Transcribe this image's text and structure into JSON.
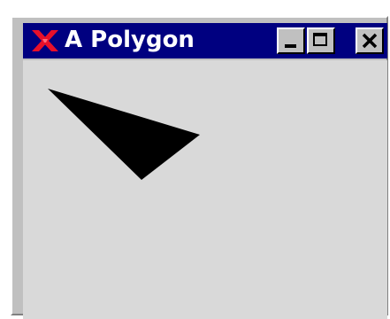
{
  "window": {
    "title": "A Polygon"
  },
  "icons": {
    "app": "x-logo-icon",
    "minimize": "minimize-icon",
    "maximize": "maximize-icon",
    "close": "close-icon"
  },
  "colors": {
    "titlebar": "#000080",
    "title_text": "#ffffff",
    "app_icon": "#e8102a",
    "client_background": "#d9d9d9",
    "polygon_fill": "#000000"
  }
}
